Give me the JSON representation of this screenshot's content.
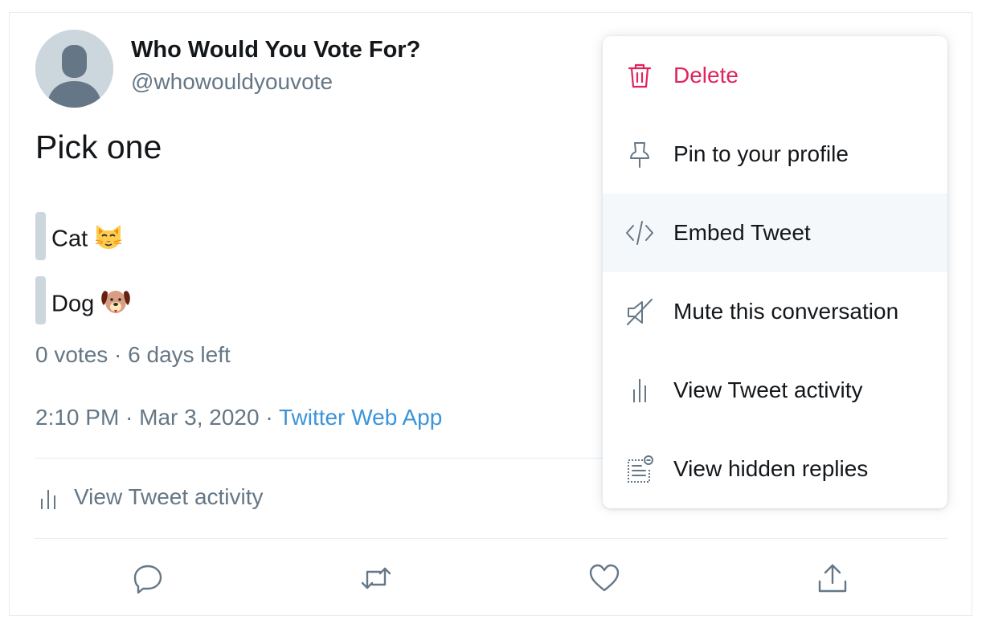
{
  "tweet": {
    "display_name": "Who Would You Vote For?",
    "handle": "@whowouldyouvote",
    "text": "Pick one",
    "poll": {
      "options": [
        {
          "label": "Cat",
          "emoji": "cat-face-emoji"
        },
        {
          "label": "Dog",
          "emoji": "dog-face-emoji"
        }
      ],
      "meta": "0 votes · 6 days left"
    },
    "timestamp": "2:10 PM · Mar 3, 2020 · ",
    "source": "Twitter Web App",
    "activity_label": "View Tweet activity",
    "actions": [
      {
        "icon": "reply-icon"
      },
      {
        "icon": "retweet-icon"
      },
      {
        "icon": "like-icon"
      },
      {
        "icon": "share-icon"
      }
    ]
  },
  "menu": {
    "items": [
      {
        "label": "Delete",
        "icon": "trash-icon",
        "color": "#e0245e"
      },
      {
        "label": "Pin to your profile",
        "icon": "pin-icon"
      },
      {
        "label": "Embed Tweet",
        "icon": "code-icon",
        "hovered": true
      },
      {
        "label": "Mute this conversation",
        "icon": "mute-icon"
      },
      {
        "label": "View Tweet activity",
        "icon": "analytics-icon"
      },
      {
        "label": "View hidden replies",
        "icon": "hidden-replies-icon"
      }
    ]
  },
  "colors": {
    "primary_text": "#14171a",
    "secondary_text": "#657786",
    "link": "#3b94d9",
    "danger": "#e0245e",
    "poll_bar": "#ccd6dd",
    "divider": "#e6ecf0",
    "hover_bg": "#f5f8fa"
  }
}
